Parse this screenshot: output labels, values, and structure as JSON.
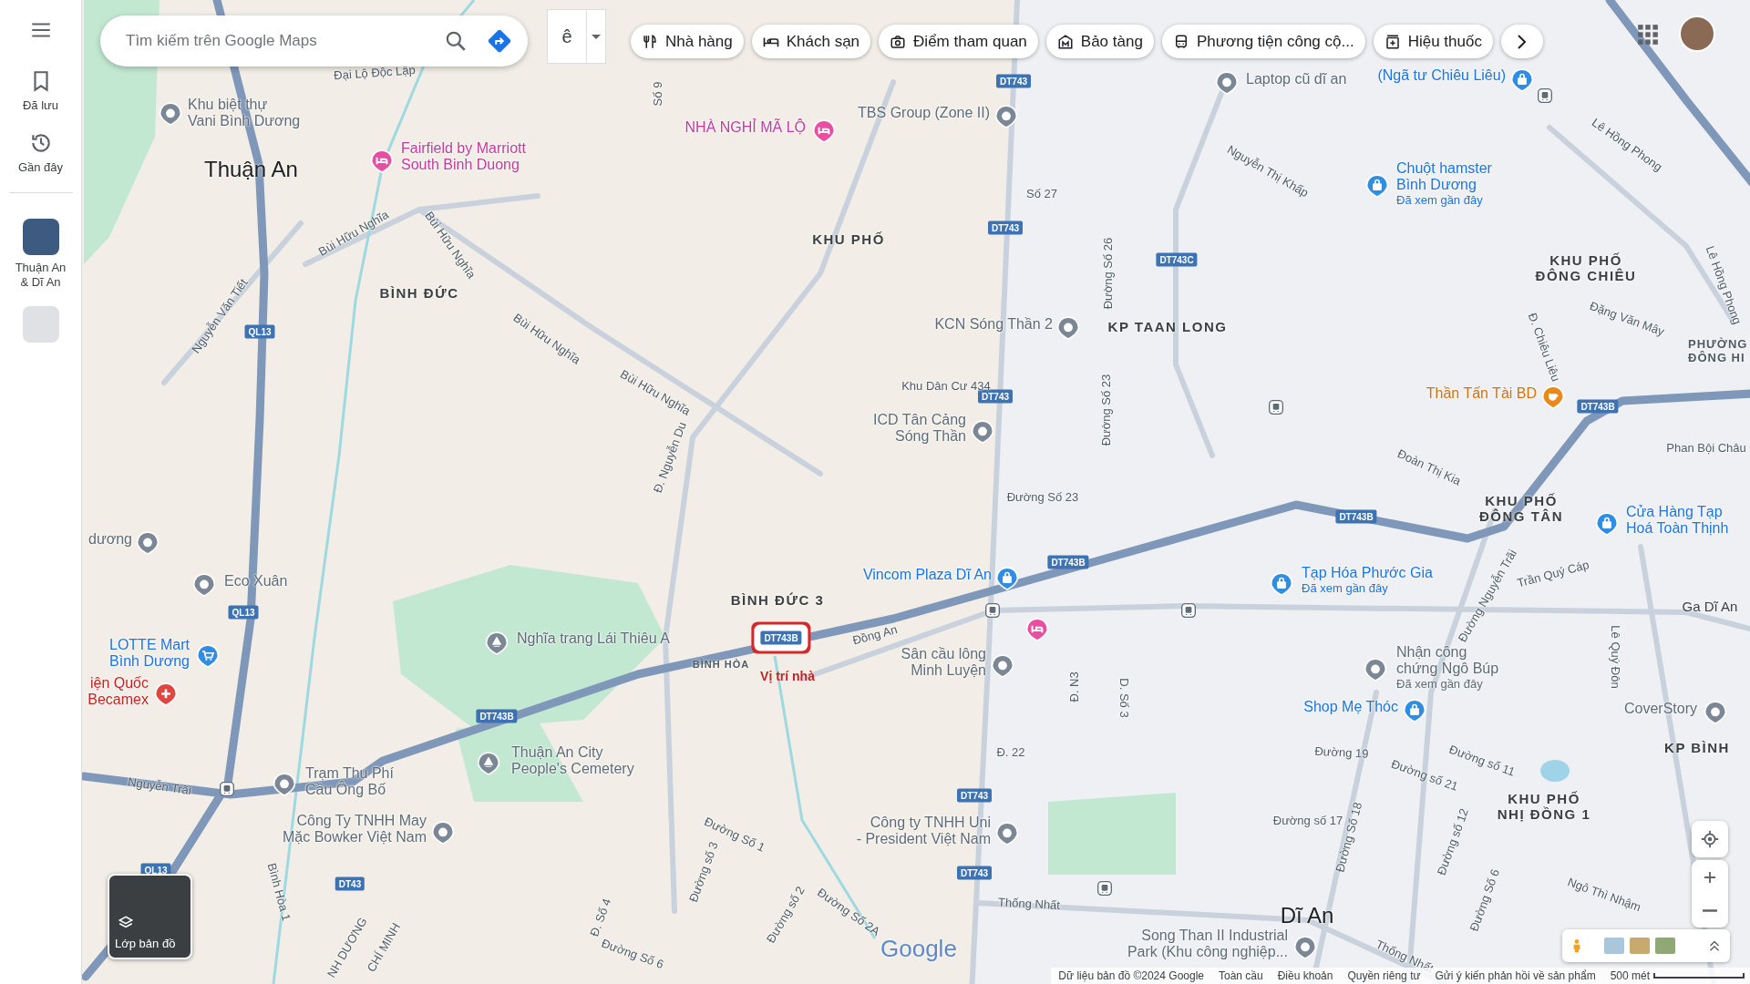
{
  "sidebar": {
    "items": [
      {
        "kind": "saved",
        "label": "Đã lưu"
      },
      {
        "kind": "recent",
        "label": "Gần đây"
      }
    ],
    "recent_places": [
      {
        "kind": "place",
        "lines": [
          "Thuận An",
          "& Dĩ An"
        ]
      },
      {
        "kind": "collection"
      }
    ]
  },
  "search": {
    "placeholder": "Tìm kiếm trên Google Maps"
  },
  "input_method": {
    "label": "ê"
  },
  "category_chips": [
    {
      "kind": "restaurant",
      "label": "Nhà hàng"
    },
    {
      "kind": "hotel",
      "label": "Khách sạn"
    },
    {
      "kind": "sights",
      "label": "Điểm tham quan"
    },
    {
      "kind": "museum",
      "label": "Bảo tàng"
    },
    {
      "kind": "transit",
      "label": "Phương tiện công cộ..."
    },
    {
      "kind": "pharmacy",
      "label": "Hiệu thuốc"
    }
  ],
  "map": {
    "area_labels": [
      {
        "kind": "city",
        "lines": [
          "Thuận An"
        ]
      },
      {
        "kind": "district",
        "lines": [
          "BÌNH ĐỨC"
        ]
      },
      {
        "kind": "district",
        "lines": [
          "KHU PHỐ"
        ]
      },
      {
        "kind": "district",
        "lines": [
          "KP TAAN LONG"
        ]
      },
      {
        "kind": "district",
        "lines": [
          "KHU PHỐ",
          "ĐÔNG CHIÊU"
        ]
      },
      {
        "kind": "district",
        "lines": [
          "PHƯỜNG",
          "ĐÔNG HI"
        ]
      },
      {
        "kind": "district",
        "lines": [
          "KHU PHỐ",
          "ĐÔNG TÂN"
        ]
      },
      {
        "kind": "district",
        "lines": [
          "BÌNH ĐỨC 3"
        ]
      },
      {
        "kind": "small",
        "lines": [
          "BÌNH HÒA"
        ]
      },
      {
        "kind": "district",
        "lines": [
          "KHU PHỐ",
          "NHỊ ĐỒNG 1"
        ]
      },
      {
        "kind": "district",
        "lines": [
          "KP BÌNH"
        ]
      },
      {
        "kind": "city",
        "lines": [
          "Dĩ An"
        ]
      },
      {
        "kind": "station",
        "lines": [
          "Ga Dĩ An"
        ]
      }
    ],
    "places": [
      {
        "kind": "pin",
        "lines": [
          "Khu biệt thự",
          "Vani Bình Dương"
        ]
      },
      {
        "kind": "hotel",
        "lines": [
          "Fairfield by Marriott",
          "South Binh Duong"
        ]
      },
      {
        "kind": "hotel",
        "lines": [
          "NHÀ NGHỈ MÃ LỘ"
        ]
      },
      {
        "kind": "pin",
        "lines": [
          "TBS Group (Zone II)"
        ]
      },
      {
        "kind": "pin",
        "lines": [
          "Laptop cũ dĩ an"
        ]
      },
      {
        "kind": "shop",
        "lines": [
          "(Ngã tư Chiêu Liêu)"
        ]
      },
      {
        "kind": "shop",
        "lines": [
          "Chuột hamster",
          "Bình Dương"
        ],
        "note": "Đã xem gần đây"
      },
      {
        "kind": "pin",
        "lines": [
          "KCN Sóng Thần 2"
        ]
      },
      {
        "kind": "pin",
        "lines": [
          "ICD Tân Cảng",
          "Sóng Thần"
        ]
      },
      {
        "kind": "food",
        "lines": [
          "Thần Tấn Tài BD"
        ]
      },
      {
        "kind": "shop",
        "lines": [
          "Cửa Hàng Tạp",
          "Hoá Toàn Thịnh"
        ]
      },
      {
        "kind": "shop",
        "lines": [
          "Vincom Plaza Dĩ An"
        ]
      },
      {
        "kind": "shop",
        "lines": [
          "Tạp Hóa Phước Gia"
        ],
        "note": "Đã xem gần đây"
      },
      {
        "kind": "hotel"
      },
      {
        "kind": "pin",
        "lines": [
          "Sân cầu lông",
          "Minh Luyện"
        ]
      },
      {
        "kind": "pin",
        "lines": [
          "Nhận công",
          "chứng Ngô Búp"
        ],
        "note": "Đã xem gần đây"
      },
      {
        "kind": "shop",
        "lines": [
          "Shop Mẹ Thóc"
        ]
      },
      {
        "kind": "pin",
        "lines": [
          "CoverStory"
        ]
      },
      {
        "kind": "pin",
        "lines": [
          "dương"
        ]
      },
      {
        "kind": "pin",
        "lines": [
          "Eco Xuân"
        ]
      },
      {
        "kind": "cart",
        "lines": [
          "LOTTE Mart",
          "Bình Dương"
        ]
      },
      {
        "kind": "hospital",
        "lines": [
          "iện Quốc",
          "Becamex"
        ]
      },
      {
        "kind": "cemetery",
        "lines": [
          "Nghĩa trang Lái Thiêu A"
        ]
      },
      {
        "kind": "cemetery",
        "lines": [
          "Thuận An City",
          "People's Cemetery"
        ]
      },
      {
        "kind": "pin",
        "lines": [
          "Trạm Thu Phí",
          "Cầu Ông Bố"
        ]
      },
      {
        "kind": "pin",
        "lines": [
          "Công Ty TNHH May",
          "Mặc Bowker Việt Nam"
        ]
      },
      {
        "kind": "pin",
        "lines": [
          "Công ty TNHH Uni",
          "- President Việt Nam"
        ]
      },
      {
        "kind": "pin",
        "lines": [
          "Song Than II Industrial",
          "Park (Khu công nghiệp..."
        ]
      }
    ],
    "streets": [
      "Đại Lộ Độc Lập",
      "Bùi Hữu Nghĩa",
      "Bùi Hữu Nghĩa",
      "Bùi Hữu Nghĩa",
      "Bùi Hữu Nghĩa",
      "Nguyễn Văn Tiết",
      "Số 9",
      "Số 27",
      "Đường Số 26",
      "Đường Số 23",
      "Khu Dân Cư 434",
      "Nguyễn Thị Khấp",
      "Lê Hồng Phong",
      "Lê Hồng Phong",
      "Đặng Văn Mây",
      "Đ. Chiêu Liêu",
      "Đường Số 23",
      "Phan Bội Châu",
      "Đoàn Thị Kia",
      "Trần Quý Cáp",
      "Đường Nguyễn Trãi",
      "Lê Quý Đôn",
      "Đồng An",
      "Đ. N3",
      "D. Số 3",
      "Đ. 22",
      "Đường 19",
      "Đường số 21",
      "Đường số 11",
      "Đường số 17",
      "Đường Số 18",
      "Đường số 12",
      "Đường Số 6",
      "Ngô Thì Nhậm",
      "Thống Nhất",
      "Thống Nhất",
      "Nguyễn Trãi",
      "Đường Số 1",
      "Đường số 3",
      "Đ. Số 4",
      "Đường Số 6",
      "Đường số 2",
      "Đường Số 2A",
      "Bình Hòa 1",
      "Đ. Nguyễn Du",
      "NH DƯƠNG",
      "CHÍ MINH"
    ],
    "route_shields": [
      {
        "label": "QL13",
        "selected": false
      },
      {
        "label": "QL13",
        "selected": false
      },
      {
        "label": "QL13",
        "selected": false
      },
      {
        "label": "DT743",
        "selected": false
      },
      {
        "label": "DT743",
        "selected": false
      },
      {
        "label": "DT743",
        "selected": false
      },
      {
        "label": "DT743",
        "selected": false
      },
      {
        "label": "DT743",
        "selected": false
      },
      {
        "label": "DT743C",
        "selected": false
      },
      {
        "label": "DT743B",
        "selected": false
      },
      {
        "label": "DT743B",
        "selected": false
      },
      {
        "label": "DT743B",
        "selected": false
      },
      {
        "label": "DT743B",
        "selected": false
      },
      {
        "label": "DT743B",
        "selected": true
      },
      {
        "label": "DT43",
        "selected": false
      }
    ],
    "annotation": {
      "label": "Vị trí nhà"
    }
  },
  "layers_button": {
    "label": "Lớp bản đồ"
  },
  "footer": {
    "logo": "Google",
    "links": [
      "Dữ liệu bản đồ ©2024 Google",
      "Toàn cầu",
      "Điều khoản",
      "Quyền riêng tư",
      "Gửi ý kiến phản hồi về sản phẩm"
    ],
    "scale": "500 mét"
  }
}
